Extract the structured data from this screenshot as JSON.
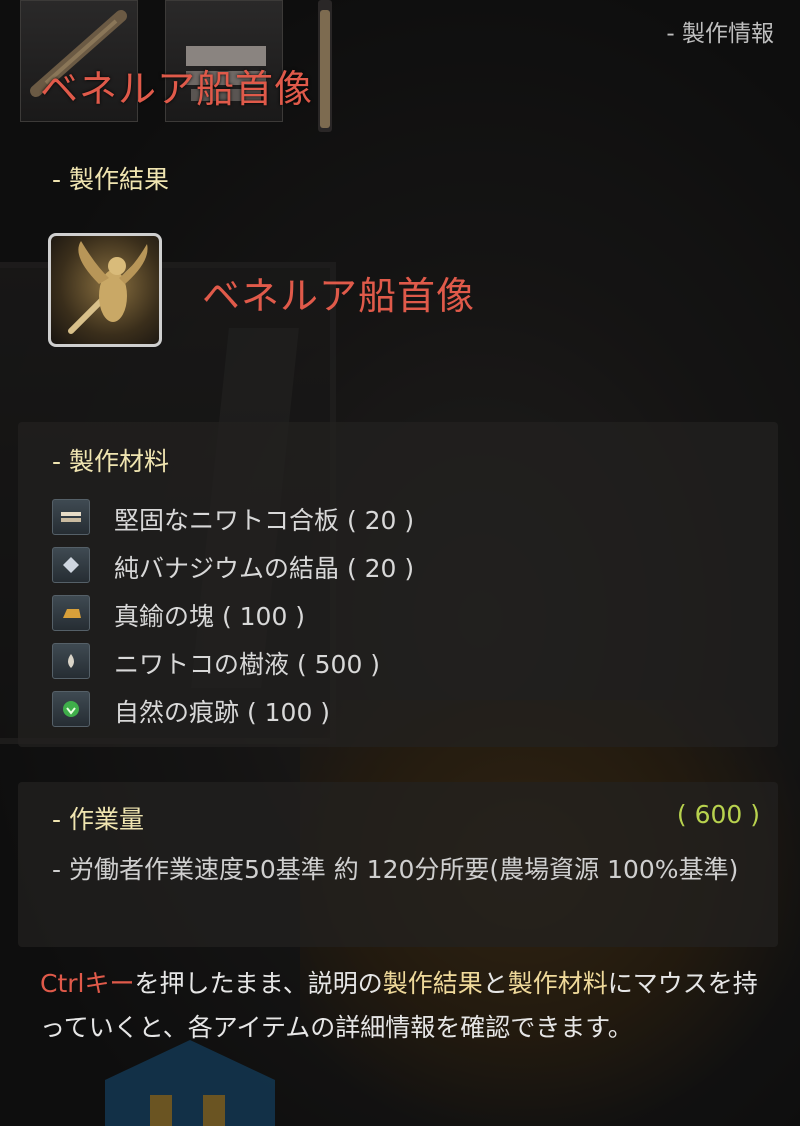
{
  "header": {
    "label": "- 製作情報"
  },
  "top": {
    "title": "ベネルア船首像"
  },
  "result": {
    "section_title": "- 製作結果",
    "item_name": "ベネルア船首像",
    "icon": "figurehead-icon"
  },
  "materials": {
    "section_title": "- 製作材料",
    "items": [
      {
        "label": "堅固なニワトコ合板 ( 20 )",
        "icon": "plywood-icon"
      },
      {
        "label": "純バナジウムの結晶 ( 20 )",
        "icon": "crystal-icon"
      },
      {
        "label": "真鍮の塊 ( 100 )",
        "icon": "ingot-icon"
      },
      {
        "label": "ニワトコの樹液 ( 500 )",
        "icon": "sap-icon"
      },
      {
        "label": "自然の痕跡 ( 100 )",
        "icon": "nature-trace-icon"
      }
    ]
  },
  "work": {
    "section_title": "- 作業量",
    "value": "( 600 )",
    "desc": "- 労働者作業速度50基準 約 120分所要(農場資源 100%基準)"
  },
  "hint": {
    "key": "Ctrlキー",
    "part1": "を押したまま、説明の",
    "kw1": "製作結果",
    "part2": "と",
    "kw2": "製作材料",
    "part3": "にマウスを持っていくと、各アイテムの詳細情報を確認できます。"
  },
  "colors": {
    "accent_red": "#e05a4a",
    "section_title": "#efe4b0",
    "work_value": "#b8d24e"
  }
}
